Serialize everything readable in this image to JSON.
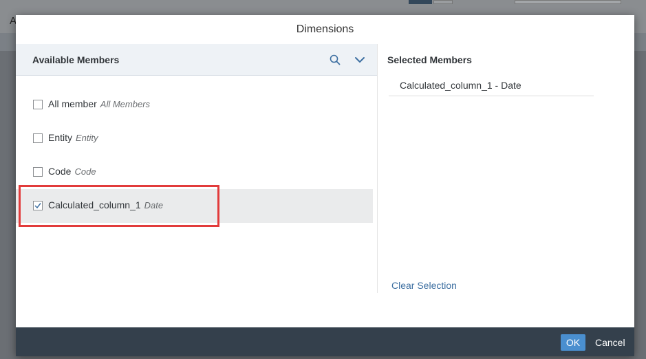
{
  "background": {
    "letter": "A"
  },
  "dialog": {
    "title": "Dimensions",
    "available": {
      "header": "Available Members",
      "members": [
        {
          "name": "All member",
          "description": "All Members",
          "checked": false
        },
        {
          "name": "Entity",
          "description": "Entity",
          "checked": false
        },
        {
          "name": "Code",
          "description": "Code",
          "checked": false
        },
        {
          "name": "Calculated_column_1",
          "description": "Date",
          "checked": true
        }
      ]
    },
    "selected": {
      "header": "Selected Members",
      "items": [
        "Calculated_column_1 - Date"
      ],
      "clear_label": "Clear Selection"
    },
    "footer": {
      "ok_label": "OK",
      "cancel_label": "Cancel"
    }
  },
  "colors": {
    "accent_link": "#3d6fa1",
    "ok_button": "#4a8fcf",
    "footer": "#34404c",
    "highlight": "#e23b3b"
  }
}
